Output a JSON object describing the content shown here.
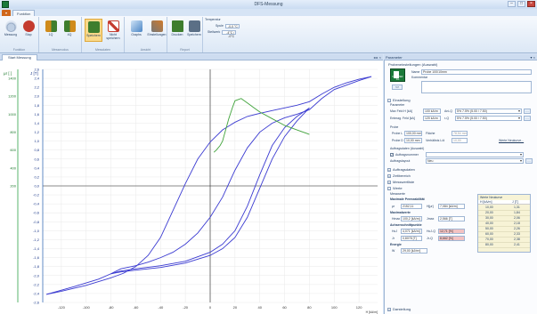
{
  "window": {
    "title": "DFS-Messung"
  },
  "ribbon": {
    "tabs": [
      "Funktion"
    ],
    "groups": [
      {
        "label": "Funktion",
        "buttons": [
          "Messung",
          "Stop"
        ]
      },
      {
        "label": "Messmodus",
        "buttons": [
          "1Q",
          "4Q"
        ]
      },
      {
        "label": "Messdaten",
        "buttons": [
          "Speichern",
          "Nicht speichern"
        ]
      },
      {
        "label": "Ansicht",
        "buttons": [
          "Graphs",
          "Einstellungen"
        ]
      },
      {
        "label": "Report",
        "buttons": [
          "Drucken",
          "Speichern"
        ]
      }
    ],
    "temperature": {
      "label": "Temperatur",
      "spule_label": "Spule",
      "spule_value": "-0,0 °C",
      "stellwerk_label": "Stellwerk",
      "stellwerk_value": "-4°C / -0°C"
    }
  },
  "left_tab": {
    "label": "Start Messung",
    "controls": "◂ ▸ ×"
  },
  "right_tab": {
    "label": "Parameter",
    "controls": "▾ ×"
  },
  "chart_data": {
    "type": "line",
    "y_left_label": "μr [ ]",
    "y_right_label": "J [T]",
    "x_ticks": [
      "-120",
      "-100",
      "-80",
      "-60",
      "-40",
      "-20",
      "0",
      "20",
      "40",
      "60",
      "80",
      "100",
      "120"
    ],
    "x_unit": "H [kA/m]",
    "y_left_ticks": [
      "1400",
      "1200",
      "1000",
      "800",
      "600",
      "400",
      "200"
    ],
    "y_right_ticks": [
      "2,6",
      "2,4",
      "2,2",
      "2,0",
      "1,8",
      "1,6",
      "1,4",
      "1,2",
      "1,0",
      "0,8",
      "0,6",
      "0,4",
      "0,2",
      "0,0",
      "-0,2",
      "-0,4",
      "-0,6",
      "-0,8",
      "-1,0",
      "-1,2",
      "-1,4",
      "-1,6",
      "-1,8",
      "-2,0",
      "-2,2",
      "-2,4",
      "-2,6"
    ],
    "xlim": [
      -135,
      135
    ],
    "ylim": [
      -2.6,
      2.6
    ],
    "series": [
      {
        "color": "#3b3bd1",
        "x": [
          -132,
          -120,
          -100,
          -80,
          -70,
          -60,
          -50,
          -40,
          -30,
          -20,
          -10,
          0,
          10,
          20,
          30,
          40,
          50,
          60,
          70,
          80,
          90,
          100,
          110,
          120,
          130
        ],
        "y": [
          -2.42,
          -2.35,
          -2.22,
          -2.05,
          -1.95,
          -1.8,
          -1.55,
          -1.15,
          -0.55,
          0.05,
          0.6,
          0.98,
          1.25,
          1.42,
          1.55,
          1.62,
          1.68,
          1.74,
          1.8,
          1.88,
          2.05,
          2.2,
          2.3,
          2.38,
          2.44
        ]
      },
      {
        "color": "#3b3bd1",
        "x": [
          -132,
          -110,
          -90,
          -80,
          -72,
          -60,
          -50,
          -40,
          -30,
          -20,
          -10,
          0,
          10,
          20,
          25,
          30,
          40,
          50,
          60,
          70,
          80,
          90,
          100,
          120,
          130
        ],
        "y": [
          -2.42,
          -2.25,
          -2.08,
          -1.96,
          -1.85,
          -1.78,
          -1.7,
          -1.6,
          -1.48,
          -1.3,
          -1.05,
          -0.7,
          -0.25,
          0.35,
          0.6,
          0.85,
          1.2,
          1.4,
          1.52,
          1.6,
          1.7,
          1.95,
          2.15,
          2.35,
          2.44
        ]
      },
      {
        "color": "#3b3bd1",
        "x": [
          -80,
          -72,
          -60,
          -40,
          -20,
          0,
          10,
          20,
          30,
          40,
          50,
          60,
          70,
          80
        ],
        "y": [
          -1.96,
          -1.9,
          -1.85,
          -1.78,
          -1.68,
          -1.48,
          -1.3,
          -1.0,
          -0.45,
          0.25,
          0.9,
          1.3,
          1.55,
          1.74
        ]
      },
      {
        "color": "#3b3bd1",
        "x": [
          -80,
          -72,
          -60,
          -40,
          -20,
          0,
          10,
          20,
          30,
          40,
          50,
          60,
          70,
          80
        ],
        "y": [
          -1.96,
          -1.92,
          -1.88,
          -1.82,
          -1.72,
          -1.55,
          -1.4,
          -1.15,
          -0.7,
          -0.05,
          0.6,
          1.1,
          1.45,
          1.74
        ]
      },
      {
        "color": "#41a33c",
        "x": [
          3,
          5,
          8,
          10,
          12,
          15,
          18,
          20,
          25,
          30,
          35,
          40,
          50,
          60,
          70,
          80
        ],
        "y": [
          0.75,
          0.8,
          0.9,
          1.0,
          1.2,
          1.5,
          1.75,
          1.9,
          1.95,
          1.85,
          1.75,
          1.65,
          1.5,
          1.35,
          1.25,
          1.15
        ]
      }
    ]
  },
  "panel": {
    "probe_section": "Probeneinstellungen (Auswahl)",
    "probe_name_label": "Name",
    "probe_name_value": "Probe 100/10mm",
    "kommentar_label": "Kommentar",
    "probe_logo_text": "FORSTER KG",
    "probe_icon_btn": "<>",
    "einstellung_label": "Einstellung",
    "parameter_label": "Parameter",
    "max_feld_label": "Max Feld H [kA]",
    "max_feld_value": "100 kA/m",
    "ani_q_label": "Ani-Q",
    "ani_q_value": "5% 7.5% (5.00 / 7.50)",
    "entmag_label": "Entmag. Feld [kA]",
    "entmag_value": "120 kA/m",
    "r_q_label": "r-Q",
    "r_q_value": "5% 7.5% (5.00 / 7.50)",
    "probe_label": "Probe",
    "probe_l_label": "Probe L",
    "probe_l_value": "100,00 mm",
    "flaeche_label": "Fläche",
    "flaeche_value": "78,54 mm²",
    "probe_d_label": "Probe D",
    "probe_d_value": "10,00 mm",
    "verhaeltnis_label": "Verhältnis L/d",
    "verhaeltnis_value": "10,00",
    "weitere_link": "Werte Neukurve...",
    "auftrag_section": "Auftragsdaten (Auswahl)",
    "auftrag_label": "Auftragsnummer",
    "auftragslayout_label": "Auftragslayout",
    "auftragslayout_value": "Neu",
    "collapse_items": [
      "Auftragsdaten",
      "Zeitbereich",
      "Messwertliste",
      "Werte"
    ],
    "messwerte_label": "Messwerte",
    "max_perm_label": "Maximale Permeabilität",
    "mur_label": "μr",
    "mur_value": "2152,11",
    "hmur_label": "H[μr]",
    "hmur_value": "7,084 [kA/m]",
    "maximalwerte_label": "Maximalwerte",
    "hmax_label": "Hmax",
    "hmax_value": "100,2 [kA/m]",
    "jmax_label": "Jmax",
    "jmax_value": "2,566 [T]",
    "achsen_label": "Achsenschnittpunkte",
    "hcj_label": "HcJ",
    "hcj_value": "4,071 [kA/m]",
    "hcjq_label": "HcJ-Q",
    "hcjq_value": "12,71 [%]",
    "jr_label": "Jr",
    "jr_value": "0,8078 [T]",
    "jrq_label": "Jr-Q",
    "jrq_value": "8,662 [%]",
    "energie_label": "Energie",
    "w_label": "W",
    "w_value": "29,00 [kJ/m³]",
    "darstellung_label": "Darstellung",
    "werte_table": {
      "title": "Werte Neukurve",
      "col_h": "H [kA/m]",
      "col_j": "J [T]",
      "rows": [
        [
          "10,00",
          "1,31"
        ],
        [
          "20,00",
          "1,84"
        ],
        [
          "30,00",
          "2,06"
        ],
        [
          "40,00",
          "2,18"
        ],
        [
          "50,00",
          "2,26"
        ],
        [
          "60,00",
          "2,33"
        ],
        [
          "70,00",
          "2,38"
        ],
        [
          "80,00",
          "2,41"
        ]
      ]
    }
  }
}
